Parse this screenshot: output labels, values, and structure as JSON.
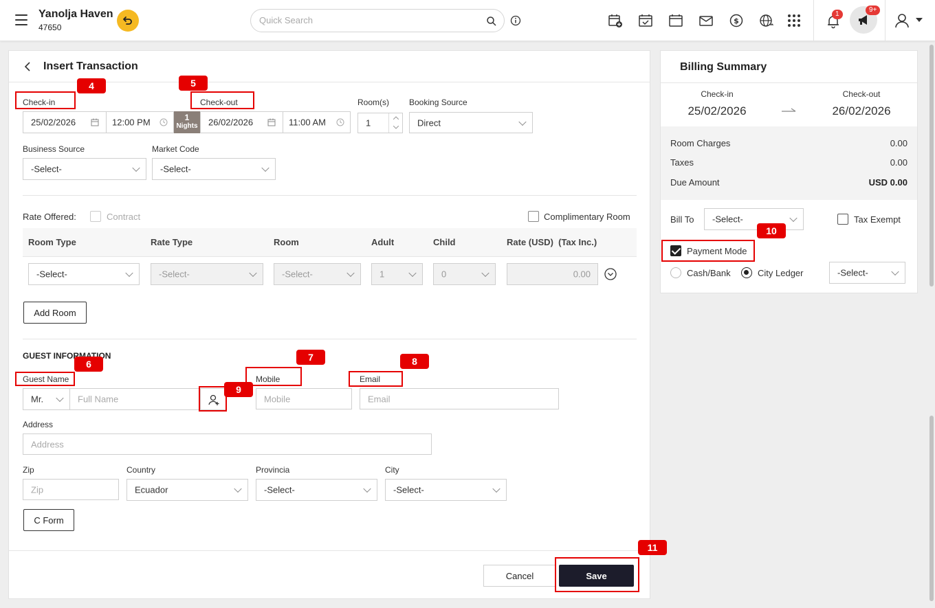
{
  "header": {
    "hotel_name": "Yanolja Haven",
    "hotel_id": "47650",
    "search_placeholder": "Quick Search",
    "notification_count": "1",
    "announcement_count": "9+"
  },
  "form": {
    "title": "Insert Transaction",
    "checkin_label": "Check-in",
    "checkin_date": "25/02/2026",
    "checkin_time": "12:00 PM",
    "nights_value": "1",
    "nights_label": "Nights",
    "checkout_label": "Check-out",
    "checkout_date": "26/02/2026",
    "checkout_time": "11:00 AM",
    "rooms_label": "Room(s)",
    "rooms_value": "1",
    "booking_source_label": "Booking Source",
    "booking_source_value": "Direct",
    "business_source_label": "Business Source",
    "business_source_value": "-Select-",
    "market_code_label": "Market Code",
    "market_code_value": "-Select-",
    "rate_offered_label": "Rate Offered:",
    "contract_label": "Contract",
    "complimentary_label": "Complimentary Room",
    "table_headers": [
      "Room Type",
      "Rate Type",
      "Room",
      "Adult",
      "Child",
      "Rate (USD)  (Tax Inc.)"
    ],
    "row": {
      "room_type": "-Select-",
      "rate_type": "-Select-",
      "room": "-Select-",
      "adult": "1",
      "child": "0",
      "rate": "0.00"
    },
    "add_room_label": "Add Room",
    "guest_section_title": "GUEST INFORMATION",
    "guest_name_label": "Guest Name",
    "salutation": "Mr.",
    "full_name_placeholder": "Full Name",
    "mobile_label": "Mobile",
    "mobile_placeholder": "Mobile",
    "email_label": "Email",
    "email_placeholder": "Email",
    "address_label": "Address",
    "address_placeholder": "Address",
    "zip_label": "Zip",
    "zip_placeholder": "Zip",
    "country_label": "Country",
    "country_value": "Ecuador",
    "provincia_label": "Provincia",
    "provincia_value": "-Select-",
    "city_label": "City",
    "city_value": "-Select-",
    "cform_label": "C Form",
    "cancel_label": "Cancel",
    "save_label": "Save"
  },
  "billing": {
    "title": "Billing Summary",
    "checkin_label": "Check-in",
    "checkin_date": "25/02/2026",
    "checkout_label": "Check-out",
    "checkout_date": "26/02/2026",
    "room_charges_label": "Room Charges",
    "room_charges_value": "0.00",
    "taxes_label": "Taxes",
    "taxes_value": "0.00",
    "due_label": "Due Amount",
    "due_value": "USD 0.00",
    "bill_to_label": "Bill To",
    "bill_to_value": "-Select-",
    "tax_exempt_label": "Tax Exempt",
    "payment_mode_label": "Payment Mode",
    "cash_bank_label": "Cash/Bank",
    "city_ledger_label": "City Ledger",
    "ledger_value": "-Select-"
  },
  "annotations": [
    "4",
    "5",
    "6",
    "7",
    "8",
    "9",
    "10",
    "11"
  ],
  "colors": {
    "accent": "#f5b922",
    "annotation_red": "#e50000",
    "save_button": "#1c1c2b"
  }
}
